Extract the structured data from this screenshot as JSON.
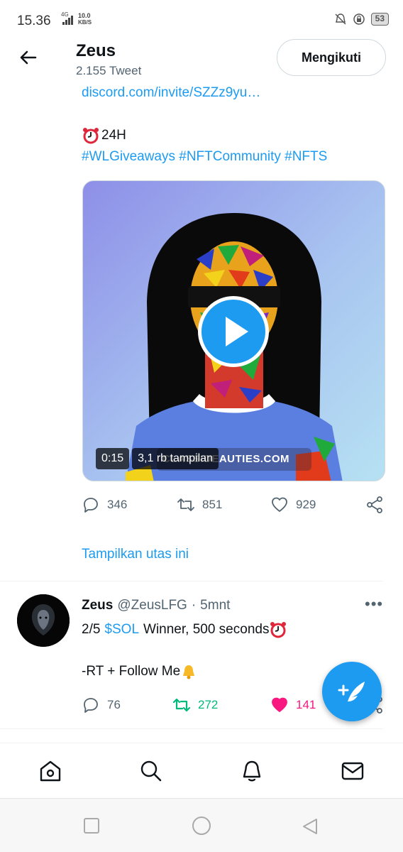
{
  "status_bar": {
    "time": "15.36",
    "network": "4G",
    "speed_value": "10.0",
    "speed_unit": "KB/S",
    "battery": "53"
  },
  "header": {
    "name": "Zeus",
    "tweet_count": "2.155 Tweet",
    "follow_label": "Mengikuti"
  },
  "tweet1": {
    "link": "discord.com/invite/SZZz9yu…",
    "timer_text": "24H",
    "hashtags": "#WLGiveaways #NFTCommunity #NFTS",
    "video_duration": "0:15",
    "video_views": "3,1 rb tampilan",
    "watermark": "CLASSIDEAUTIES.COM",
    "replies": "346",
    "retweets": "851",
    "likes": "929",
    "show_thread": "Tampilkan utas ini"
  },
  "tweet2": {
    "name": "Zeus",
    "handle": "@ZeusLFG",
    "separator": "·",
    "time": "5mnt",
    "more": "•••",
    "prefix": "2/5",
    "cashtag": "$SOL",
    "body": "Winner, 500 seconds",
    "line2": "-RT + Follow Me",
    "replies": "76",
    "retweets": "272",
    "likes": "141"
  },
  "colors": {
    "accent": "#1d9bf0",
    "retweet_active": "#00ba7c",
    "like_active": "#f91880",
    "secondary_text": "#536471"
  },
  "icons": {
    "back": "arrow-left-icon",
    "reply": "comment-icon",
    "retweet": "retweet-icon",
    "like": "heart-icon",
    "share": "share-icon",
    "compose": "compose-feather-icon",
    "nav": [
      "home-icon",
      "search-icon",
      "notifications-icon",
      "messages-icon"
    ],
    "system": [
      "recents-square-icon",
      "home-circle-icon",
      "back-triangle-icon"
    ]
  }
}
